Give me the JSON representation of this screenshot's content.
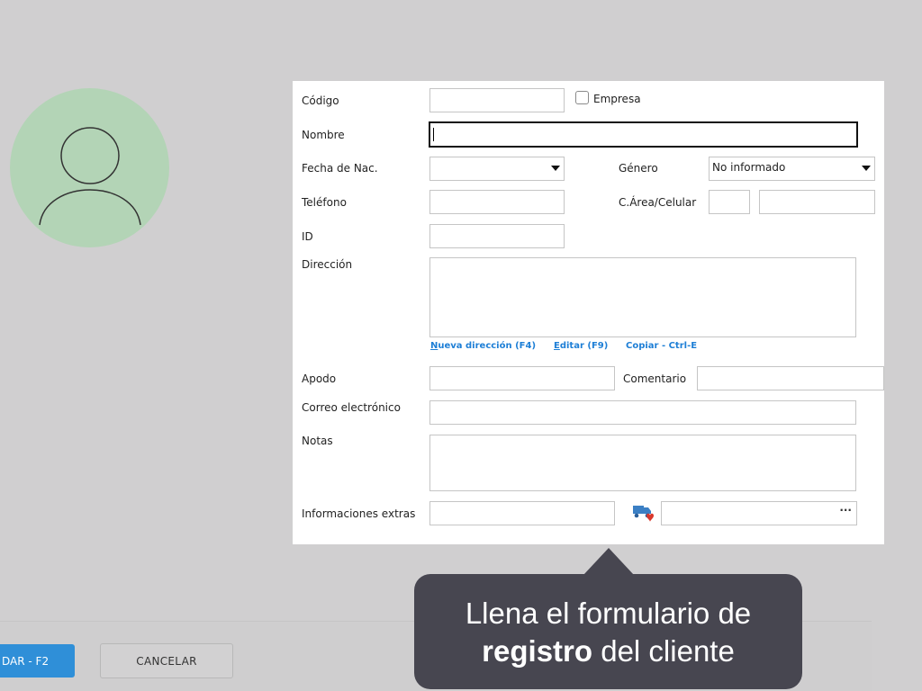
{
  "form": {
    "codigo_label": "Código",
    "empresa_label": "Empresa",
    "nombre_label": "Nombre",
    "fecha_label": "Fecha de Nac.",
    "genero_label": "Género",
    "genero_value": "No informado",
    "telefono_label": "Teléfono",
    "area_celular_label": "C.Área/Celular",
    "id_label": "ID",
    "direccion_label": "Dirección",
    "nueva_direccion_link": "ueva dirección (F4)",
    "nueva_direccion_accel": "N",
    "editar_link": "ditar (F9)",
    "editar_accel": "E",
    "copiar_link": "Copiar - Ctrl-E",
    "apodo_label": "Apodo",
    "comentario_label": "Comentario",
    "correo_label": "Correo electrónico",
    "notas_label": "Notas",
    "info_extras_label": "Informaciones extras",
    "ellipsis_button": "···"
  },
  "footer": {
    "save_label": "DAR - F2",
    "cancel_label": "CANCELAR"
  },
  "tooltip": {
    "line1": "Llena el formulario de",
    "bold": "registro",
    "rest": " del cliente"
  },
  "colors": {
    "accent": "#2f8fd8",
    "link": "#1e7fd6",
    "tooltip_bg": "#474650",
    "avatar_bg": "#b3d4b6"
  }
}
